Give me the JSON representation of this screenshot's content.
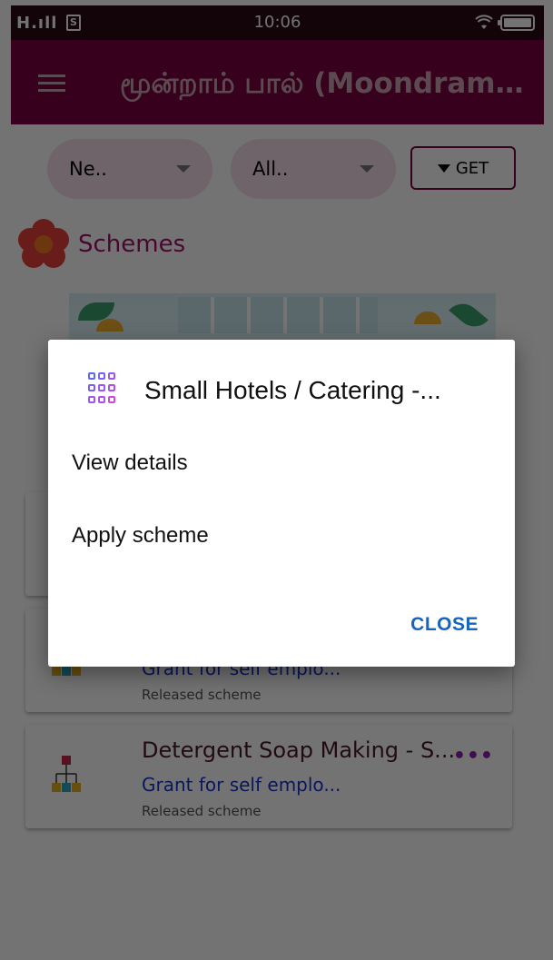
{
  "status_bar": {
    "signal": "H.ıll",
    "sim": "S",
    "time": "10:06"
  },
  "app_bar": {
    "title": "மூன்றாம் பால் (Moondram P..."
  },
  "filters": {
    "first": "Ne..",
    "second": "All..",
    "get_label": "GET"
  },
  "section": {
    "title": "Schemes"
  },
  "cards": [
    {
      "title": "",
      "subtitle": "",
      "status": ""
    },
    {
      "title": "",
      "subtitle": "Grant for self emplo...",
      "status": "Released scheme"
    },
    {
      "title": "Detergent Soap Making - S...",
      "subtitle": "Grant for self emplo...",
      "status": "Released scheme"
    }
  ],
  "dialog": {
    "title": "Small Hotels / Catering -...",
    "items": [
      "View details",
      "Apply scheme"
    ],
    "close_label": "CLOSE"
  },
  "colors": {
    "app_bar": "#7a0040",
    "accent": "#a0106a",
    "link": "#1565c0"
  }
}
